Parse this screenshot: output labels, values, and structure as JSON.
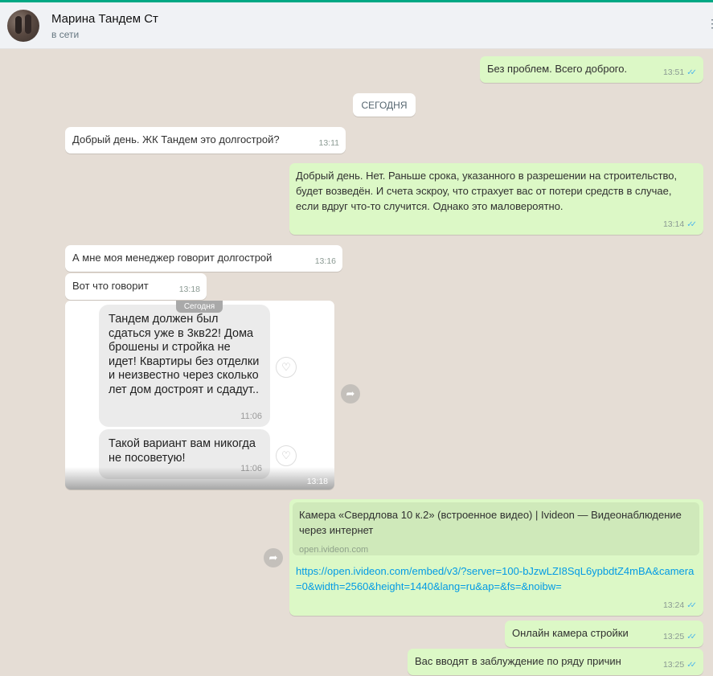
{
  "header": {
    "contact_name": "Марина Тандем Ст",
    "status": "в сети"
  },
  "day_chip": "СЕГОДНЯ",
  "messages": [
    {
      "text": "Без проблем. Всего доброго.",
      "time": "13:51",
      "direction": "out"
    },
    {
      "text": "Добрый день. ЖК Тандем это долгострой?",
      "time": "13:11",
      "direction": "in"
    },
    {
      "text": "Добрый день. Нет. Раньше срока, указанного в разрешении на строительство, будет возведён. И счета эскроу, что страхует вас от потери средств в случае, если вдруг что-то случится. Однако это маловероятно.",
      "time": "13:14",
      "direction": "out"
    },
    {
      "text": "А мне моя менеджер говорит долгострой",
      "time": "13:16",
      "direction": "in"
    },
    {
      "text": "Вот что говорит",
      "time": "13:18",
      "direction": "in"
    }
  ],
  "image_message": {
    "time": "13:18",
    "chip": "Сегодня",
    "card1": {
      "text": "Тандем должен был сдаться уже в 3кв22! Дома брошены и стройка не идет! Квартиры без отделки и неизвестно через сколько лет дом достроят и сдадут..",
      "time": "11:06"
    },
    "card2": {
      "text": "Такой вариант вам никогда не посоветую!",
      "time": "11:06"
    }
  },
  "link_message": {
    "preview_title": "Камера «Свердлова 10 к.2» (встроенное видео) | Ivideon — Видеонаблюдение через интернет",
    "preview_domain": "open.ivideon.com",
    "url": "https://open.ivideon.com/embed/v3/?server=100-bJzwLZI8SqL6ypbdtZ4mBA&camera=0&width=2560&height=1440&lang=ru&ap=&fs=&noibw=",
    "time": "13:24"
  },
  "messages_tail": [
    {
      "text": "Онлайн камера стройки",
      "time": "13:25",
      "direction": "out"
    },
    {
      "text": "Вас вводят в заблуждение по ряду причин",
      "time": "13:25",
      "direction": "out"
    }
  ],
  "icons": {
    "ticks": "✓✓",
    "forward": "➦",
    "heart": "♡",
    "menu": "⋮"
  },
  "colors": {
    "outgoing_bubble": "#dcf8c6",
    "incoming_bubble": "#ffffff",
    "chat_background": "#e5ddd5",
    "link": "#039be5",
    "read_ticks": "#4fb6ec"
  }
}
